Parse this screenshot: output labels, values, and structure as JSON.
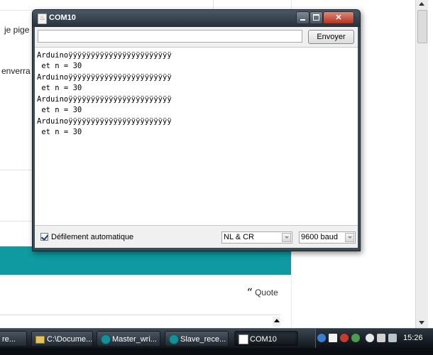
{
  "background_page": {
    "snippet_1": "je pige",
    "snippet_2": "enverra",
    "quote_label": "Quote",
    "quote_icon": "quote-marks-icon",
    "accent_color": "#0e9aa0"
  },
  "serial_monitor": {
    "title": "COM10",
    "input_value": "",
    "send_label": "Envoyer",
    "output_lines": [
      "Arduinoÿÿÿÿÿÿÿÿÿÿÿÿÿÿÿÿÿÿÿÿÿÿÿ",
      " et n = 30",
      "Arduinoÿÿÿÿÿÿÿÿÿÿÿÿÿÿÿÿÿÿÿÿÿÿÿ",
      " et n = 30",
      "Arduinoÿÿÿÿÿÿÿÿÿÿÿÿÿÿÿÿÿÿÿÿÿÿÿ",
      " et n = 30",
      "Arduinoÿÿÿÿÿÿÿÿÿÿÿÿÿÿÿÿÿÿÿÿÿÿÿ",
      " et n = 30"
    ],
    "autoscroll_label": "Défilement automatique",
    "autoscroll_checked": true,
    "line_ending": "NL & CR",
    "baud_rate": "9600 baud"
  },
  "taskbar": {
    "items": [
      {
        "label": "re...",
        "icon": "blank-icon"
      },
      {
        "label": "C:\\Docume...",
        "icon": "folder-icon"
      },
      {
        "label": "Master_wri...",
        "icon": "arduino-icon"
      },
      {
        "label": "Slave_rece...",
        "icon": "arduino-icon"
      },
      {
        "label": "COM10",
        "icon": "java-icon"
      }
    ],
    "clock": "15:26"
  }
}
